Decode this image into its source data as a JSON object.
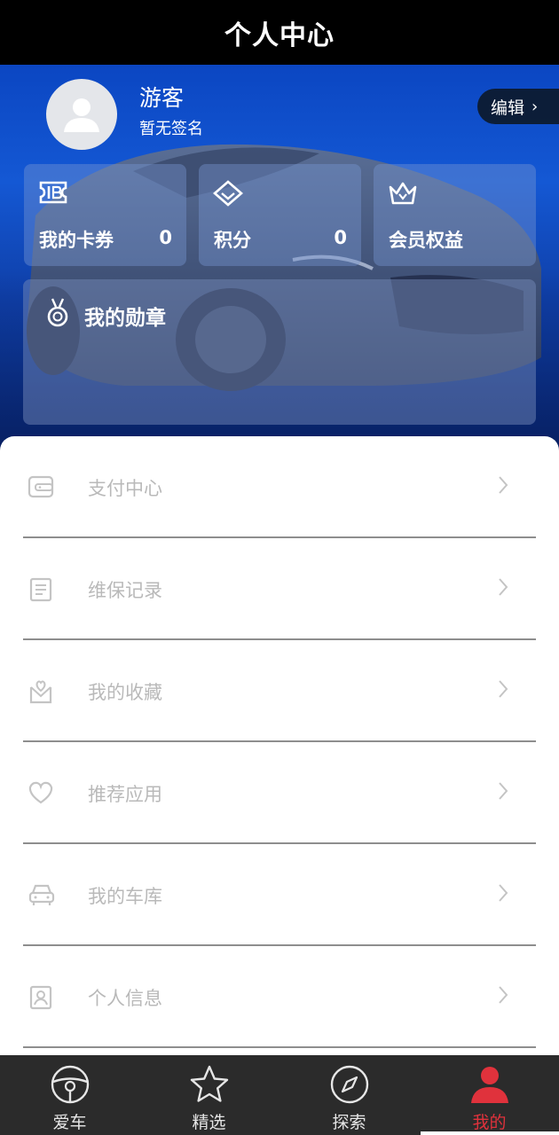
{
  "header": {
    "title": "个人中心"
  },
  "profile": {
    "name": "游客",
    "signature": "暂无签名",
    "edit_label": "编辑",
    "edit_chevron": "›"
  },
  "stats": [
    {
      "icon": "ticket-icon",
      "label": "我的卡券",
      "value": "0"
    },
    {
      "icon": "diamond-icon",
      "label": "积分",
      "value": "0"
    },
    {
      "icon": "crown-icon",
      "label": "会员权益"
    }
  ],
  "medals": {
    "icon": "medal-icon",
    "label": "我的勋章"
  },
  "menu": [
    {
      "icon": "wallet-icon",
      "label": "支付中心"
    },
    {
      "icon": "document-icon",
      "label": "维保记录"
    },
    {
      "icon": "favorite-box-icon",
      "label": "我的收藏"
    },
    {
      "icon": "heart-icon",
      "label": "推荐应用"
    },
    {
      "icon": "car-icon",
      "label": "我的车库"
    },
    {
      "icon": "id-card-icon",
      "label": "个人信息"
    }
  ],
  "tabbar": {
    "active": 3,
    "accent": "#e0323c",
    "items": [
      {
        "icon": "steering-wheel-icon",
        "label": "爱车"
      },
      {
        "icon": "star-icon",
        "label": "精选"
      },
      {
        "icon": "compass-icon",
        "label": "探索"
      },
      {
        "icon": "user-icon",
        "label": "我的"
      }
    ]
  }
}
